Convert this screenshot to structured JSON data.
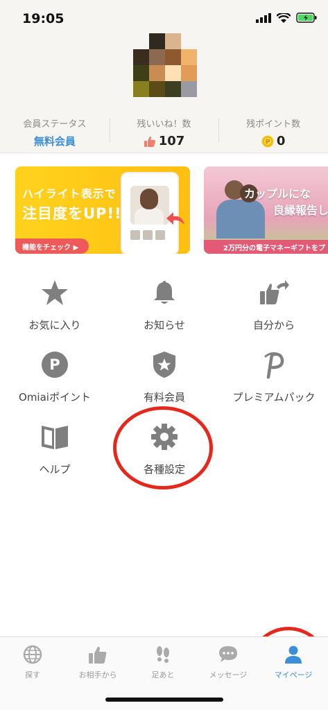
{
  "status_bar": {
    "time": "19:05"
  },
  "stats": [
    {
      "label": "会員ステータス",
      "value": "無料会員"
    },
    {
      "label": "残いいね！数",
      "value": "107"
    },
    {
      "label": "残ポイント数",
      "value": "0"
    }
  ],
  "banners": [
    {
      "title1": "ハイライト表示で",
      "title2": "注目度をUP!!",
      "button": "機能をチェック ▶"
    },
    {
      "title1": "カップルにな",
      "title2": "良縁報告し",
      "strip": "2万円分の電子マネーギフトをプ"
    }
  ],
  "menu": [
    {
      "label": "お気に入り",
      "icon": "star-icon"
    },
    {
      "label": "お知らせ",
      "icon": "bell-icon"
    },
    {
      "label": "自分から",
      "icon": "thumbs-up-share-icon"
    },
    {
      "label": "Omiaiポイント",
      "icon": "point-icon"
    },
    {
      "label": "有料会員",
      "icon": "shield-star-icon"
    },
    {
      "label": "プレミアムパック",
      "icon": "premium-p-icon"
    },
    {
      "label": "ヘルプ",
      "icon": "book-icon"
    },
    {
      "label": "各種設定",
      "icon": "gear-icon"
    }
  ],
  "tabs": [
    {
      "label": "探す",
      "icon": "globe-icon"
    },
    {
      "label": "お相手から",
      "icon": "thumbs-up-icon"
    },
    {
      "label": "足あと",
      "icon": "footprints-icon"
    },
    {
      "label": "メッセージ",
      "icon": "chat-icon"
    },
    {
      "label": "マイページ",
      "icon": "person-icon",
      "active": true
    }
  ],
  "colors": {
    "accent_blue": "#3c8fd6",
    "highlight_red": "#e6271b",
    "icon_gray": "#808080"
  }
}
